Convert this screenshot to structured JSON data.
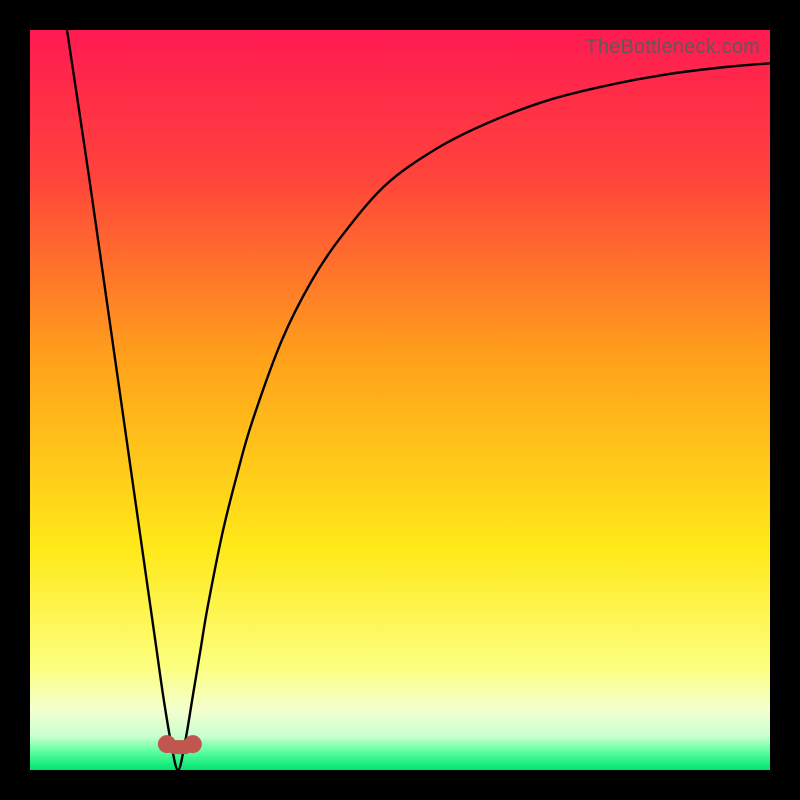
{
  "watermark": {
    "text": "TheBottleneck.com"
  },
  "chart_data": {
    "type": "line",
    "title": "",
    "xlabel": "",
    "ylabel": "",
    "xlim": [
      0,
      100
    ],
    "ylim": [
      0,
      100
    ],
    "optimum_x": 20,
    "gradient_stops": [
      {
        "pos": 0.0,
        "color": "#ff1a52"
      },
      {
        "pos": 0.2,
        "color": "#ff443b"
      },
      {
        "pos": 0.45,
        "color": "#ffa31a"
      },
      {
        "pos": 0.7,
        "color": "#ffe919"
      },
      {
        "pos": 0.86,
        "color": "#fdff7e"
      },
      {
        "pos": 0.92,
        "color": "#f3ffcf"
      },
      {
        "pos": 0.955,
        "color": "#c8ffcf"
      },
      {
        "pos": 0.975,
        "color": "#5cffa0"
      },
      {
        "pos": 1.0,
        "color": "#00e36e"
      }
    ],
    "series": [
      {
        "name": "bottleneck-curve",
        "x": [
          5,
          8,
          10,
          12,
          14,
          16,
          17,
          18,
          19,
          20,
          21,
          22,
          23,
          24,
          26,
          28,
          30,
          34,
          38,
          42,
          48,
          55,
          62,
          70,
          78,
          86,
          94,
          100
        ],
        "y": [
          100,
          80,
          66,
          52,
          38,
          24,
          17,
          10,
          4,
          0,
          4,
          10,
          16,
          22,
          32,
          40,
          47,
          58,
          66,
          72,
          79,
          84,
          87.5,
          90.5,
          92.5,
          94,
          95,
          95.5
        ]
      }
    ],
    "markers": [
      {
        "name": "optimum-left",
        "x": 18.5,
        "y": 3.5,
        "color": "#c1564e",
        "r": 9
      },
      {
        "name": "optimum-right",
        "x": 22.0,
        "y": 3.5,
        "color": "#c1564e",
        "r": 9
      }
    ]
  }
}
